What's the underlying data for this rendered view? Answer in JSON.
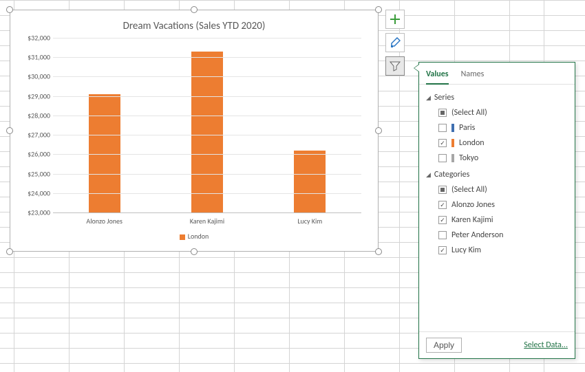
{
  "chart_data": {
    "type": "bar",
    "title": "Dream Vacations (Sales YTD 2020)",
    "categories": [
      "Alonzo Jones",
      "Karen Kajimi",
      "Lucy Kim"
    ],
    "series": [
      {
        "name": "London",
        "color": "#ed7d31",
        "values": [
          29100,
          31300,
          26200
        ]
      }
    ],
    "xlabel": "",
    "ylabel": "",
    "ylim": [
      23000,
      32000
    ],
    "y_ticks": [
      32000,
      31000,
      30000,
      29000,
      28000,
      27000,
      26000,
      25000,
      24000,
      23000
    ],
    "y_tick_labels": [
      "$32,000",
      "$31,000",
      "$30,000",
      "$29,000",
      "$28,000",
      "$27,000",
      "$26,000",
      "$25,000",
      "$24,000",
      "$23,000"
    ]
  },
  "legend": {
    "label": "London"
  },
  "tool_buttons": {
    "plus": "plus-icon",
    "brush": "brush-icon",
    "filter": "funnel-icon"
  },
  "filter_panel": {
    "tabs": {
      "values": "Values",
      "names": "Names",
      "active": "values"
    },
    "groups": [
      {
        "title": "Series",
        "select_all_label": "(Select All)",
        "select_all_state": "mixed",
        "items": [
          {
            "label": "Paris",
            "checked": false,
            "swatch": "#3f6fb0"
          },
          {
            "label": "London",
            "checked": true,
            "swatch": "#ed7d31"
          },
          {
            "label": "Tokyo",
            "checked": false,
            "swatch": "#a6a6a6"
          }
        ]
      },
      {
        "title": "Categories",
        "select_all_label": "(Select All)",
        "select_all_state": "mixed",
        "items": [
          {
            "label": "Alonzo Jones",
            "checked": true
          },
          {
            "label": "Karen Kajimi",
            "checked": true
          },
          {
            "label": "Peter Anderson",
            "checked": false
          },
          {
            "label": "Lucy Kim",
            "checked": true
          }
        ]
      }
    ],
    "apply_label": "Apply",
    "select_data_label": "Select Data..."
  }
}
